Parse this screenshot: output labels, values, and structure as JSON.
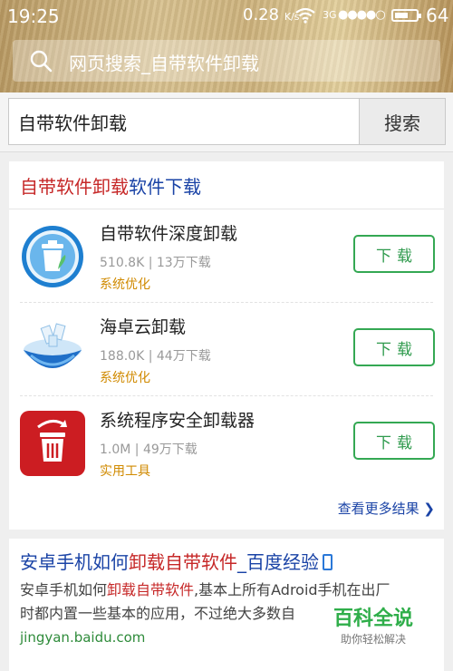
{
  "status_bar": {
    "time": "19:25",
    "speed": "0.28",
    "speed_unit": "K/s",
    "network": "3G",
    "signal": "●●●●○",
    "battery": "64",
    "battery_level": 0.64
  },
  "top_search": {
    "text": "网页搜索_自带软件卸载"
  },
  "search": {
    "value": "自带软件卸载",
    "button_label": "搜索"
  },
  "app_section": {
    "title_highlight": "自带软件卸载",
    "title_rest": "软件下载",
    "apps": [
      {
        "name": "自带软件深度卸载",
        "meta": "510.8K | 13万下载",
        "category": "系统优化",
        "download_label": "下载",
        "icon": "trash-bin-icon"
      },
      {
        "name": "海卓云卸载",
        "meta": "188.0K | 44万下载",
        "category": "系统优化",
        "download_label": "下载",
        "icon": "globe-bowl-icon"
      },
      {
        "name": "系统程序安全卸载器",
        "meta": "1.0M | 49万下载",
        "category": "实用工具",
        "download_label": "下载",
        "icon": "red-trash-icon"
      }
    ],
    "more_label": "查看更多结果",
    "more_arrow": "❯"
  },
  "result": {
    "title_pre": "安卓手机如何",
    "title_hl": "卸载自带软件",
    "title_post": "_百度经验",
    "snippet_line1_pre": "安卓手机如何",
    "snippet_line1_hl": "卸载自带软件",
    "snippet_line1_post": ",基本上所有Adroid手机在出厂",
    "snippet_line2": "时都内置一些基本的应用，不过绝大多数自",
    "url": "jingyan.baidu.com"
  },
  "watermark": {
    "main": "百科全说",
    "sub": "助你轻松解决"
  },
  "colors": {
    "accent_red": "#c62828",
    "link_blue": "#1a43a6",
    "download_green": "#34a853",
    "category_orange": "#d08a00"
  }
}
